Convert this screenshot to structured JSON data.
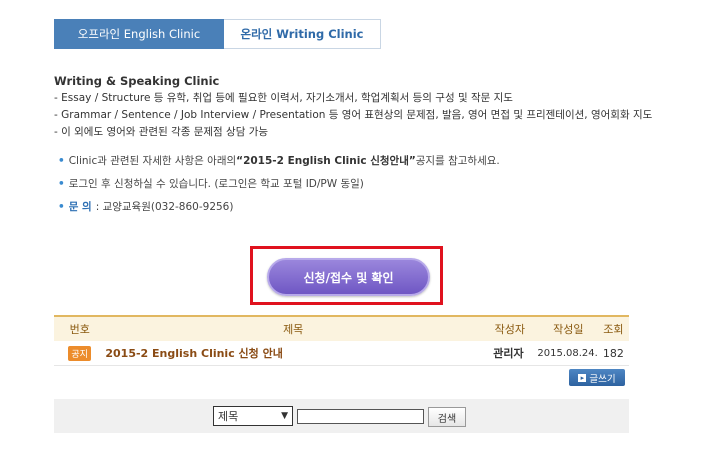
{
  "tabs": [
    {
      "label": "오프라인 English Clinic",
      "active": true
    },
    {
      "label": "온라인 Writing Clinic",
      "active": false
    }
  ],
  "intro": {
    "title": "Writing & Speaking Clinic",
    "lines": [
      "- Essay / Structure 등 유학, 취업 등에 필요한 이력서, 자기소개서, 학업계획서 등의 구성 및 작문 지도",
      "- Grammar / Sentence / Job Interview / Presentation 등 영어 표현상의 문제점, 발음, 영어 면접 및 프리젠테이션, 영어회화 지도",
      "- 이 외에도 영어와 관련된 각종 문제점 상담 가능"
    ]
  },
  "info": {
    "line1_pre": "Clinic과 관련된 자세한 사항은 아래의 ",
    "line1_strong": "“2015-2 English Clinic 신청안내”",
    "line1_post": " 공지를 참고하세요.",
    "line2": "로그인 후 신청하실 수 있습니다. (로그인은 학교 포털 ID/PW 동일)",
    "contact_label": "문 의",
    "contact_value": ": 교양교육원(032-860-9256)"
  },
  "apply_button": {
    "label": "신청/접수 및 확인"
  },
  "board": {
    "headers": {
      "no": "번호",
      "title": "제목",
      "author": "작성자",
      "date": "작성일",
      "views": "조회"
    },
    "rows": [
      {
        "badge": "공지",
        "title": "2015-2 English Clinic 신청 안내",
        "author": "관리자",
        "date": "2015.08.24.",
        "views": "182"
      }
    ]
  },
  "write_button": {
    "label": "글쓰기"
  },
  "search": {
    "selected": "제목",
    "button": "검색",
    "value": ""
  },
  "colors": {
    "tab_active": "#4a80b8",
    "highlight": "#e0121e",
    "apply_button": "#7b63cc",
    "board_accent": "#e1b760"
  }
}
